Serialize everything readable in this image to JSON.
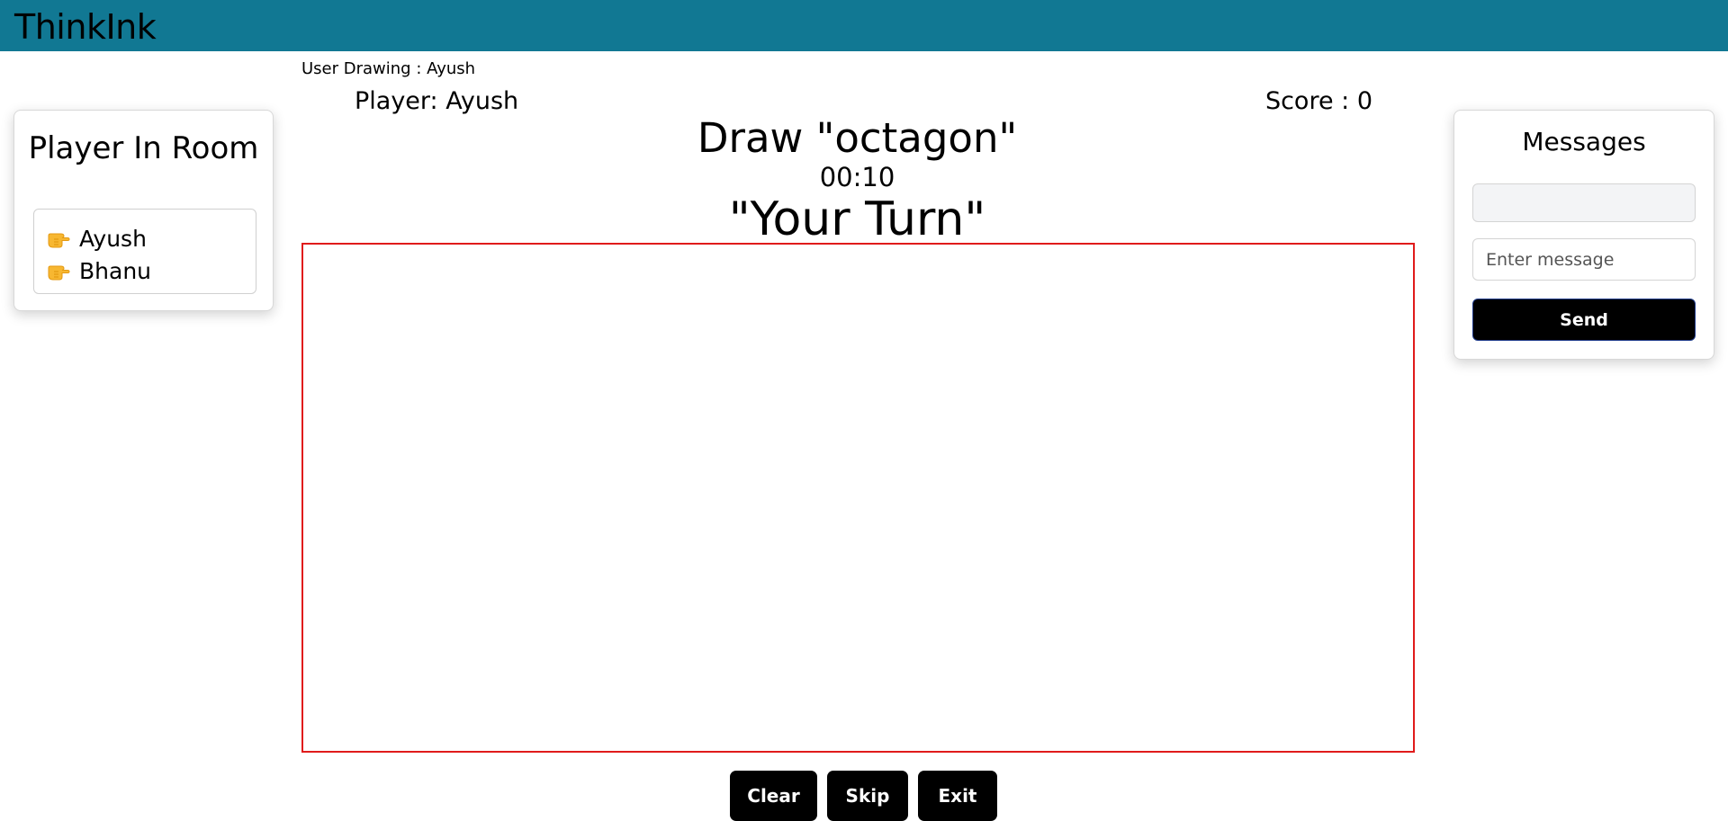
{
  "app": {
    "brand": "ThinkInk"
  },
  "game": {
    "user_drawing": "User Drawing : Ayush",
    "player_label": "Player: Ayush",
    "score_label": "Score : 0",
    "word_prompt": "Draw \"octagon\"",
    "timer": "00:10",
    "turn_status": "\"Your Turn\""
  },
  "controls": {
    "clear_label": "Clear",
    "skip_label": "Skip",
    "exit_label": "Exit"
  },
  "players_panel": {
    "title": "Player In Room",
    "icon": "pointing-hand-icon",
    "players": [
      {
        "name": "Ayush"
      },
      {
        "name": "Bhanu"
      }
    ]
  },
  "messages_panel": {
    "title": "Messages",
    "message_display_value": "",
    "input_placeholder": "Enter message",
    "send_label": "Send"
  },
  "colors": {
    "navbar": "#117893",
    "canvas_border": "#e01b1b",
    "button_bg": "#000000",
    "button_text": "#ffffff"
  }
}
